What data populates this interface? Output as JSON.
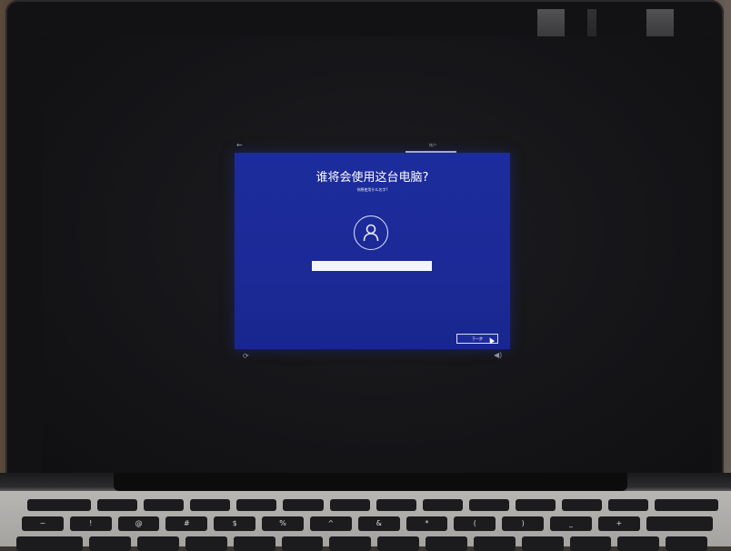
{
  "oobe": {
    "step_label": "帐户",
    "back_glyph": "←",
    "title": "谁将会使用这台电脑?",
    "subtitle": "你想使用什么名字?",
    "name_input_value": "",
    "name_input_placeholder": "",
    "next_button_label": "下一步",
    "panel_color": "#1d2c9c"
  },
  "footer": {
    "ease_of_access_glyph": "⟳",
    "volume_glyph": "◀)"
  },
  "keyboard": {
    "row1": [
      "",
      "",
      "",
      "",
      "",
      "",
      "",
      "",
      "",
      "",
      "",
      "",
      "",
      ""
    ],
    "row2": [
      "~",
      "!",
      "@",
      "#",
      "$",
      "%",
      "^",
      "&",
      "*",
      "(",
      ")",
      "_",
      "+",
      ""
    ],
    "row3": [
      "",
      "",
      "",
      "",
      "",
      "",
      "",
      "",
      "",
      "",
      "",
      "",
      "",
      ""
    ]
  }
}
